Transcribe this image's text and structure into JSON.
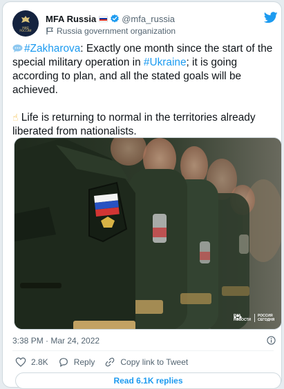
{
  "tweet": {
    "display_name": "MFA Russia",
    "handle": "@mfa_russia",
    "org_label": "Russia government organization",
    "avatar_text": "МИД РОССИИ",
    "body": {
      "line1_tag": "#Zakharova",
      "line1_rest": ": Exactly one month since the start of the special military operation in ",
      "line1_tag2": "#Ukraine",
      "line1_end": "; it is going according to plan, and all the stated goals will be achieved.",
      "line2_emoji": "☝",
      "line2_text": " Life is returning to normal in the territories already liberated from nationalists."
    },
    "photo": {
      "watermark_brand": "РИА НОВОСТИ",
      "watermark_sub": "РОССИЯ СЕГОДНЯ"
    },
    "timestamp": "3:38 PM · Mar 24, 2022",
    "actions": {
      "like_count": "2.8K",
      "reply_label": "Reply",
      "copy_label": "Copy link to Tweet"
    },
    "read_replies_label": "Read 6.1K replies"
  },
  "colors": {
    "link": "#1d9bf0",
    "secondary_text": "#536471",
    "border": "#cfd9de"
  },
  "icons": {
    "verified": "verified-badge-icon",
    "twitter": "twitter-bird-icon",
    "org_flag": "flag-icon",
    "info": "info-icon",
    "like": "heart-icon",
    "reply": "reply-icon",
    "copy": "link-icon",
    "speech": "speech-bubble-icon"
  }
}
